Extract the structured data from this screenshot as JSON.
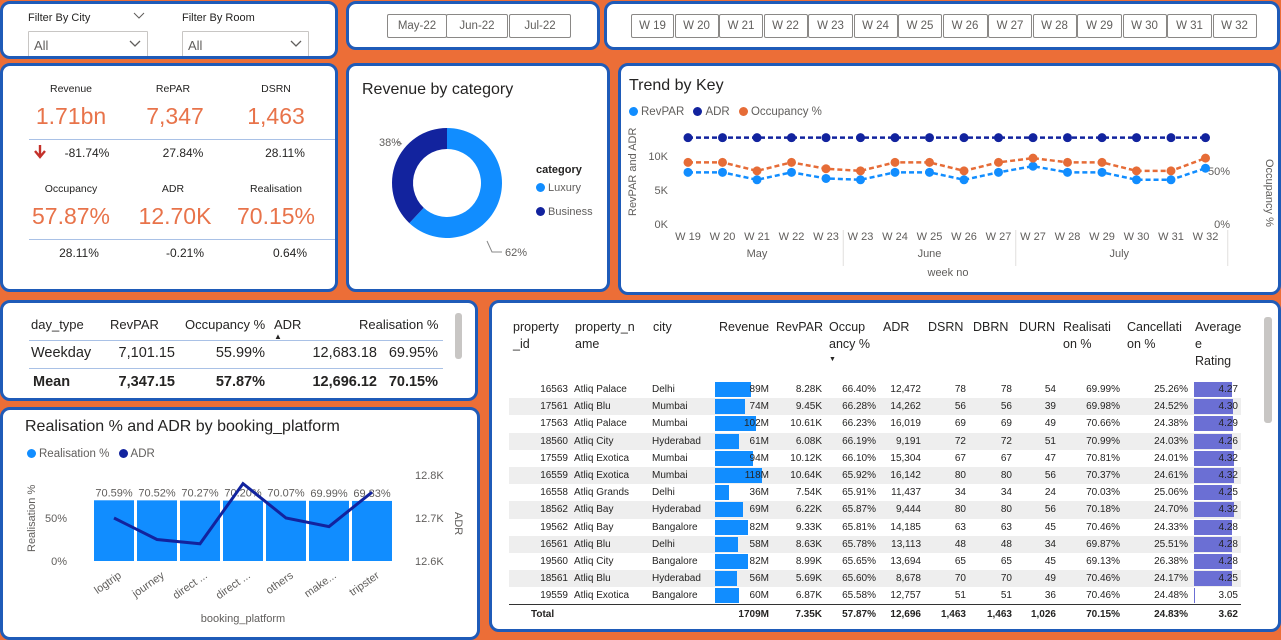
{
  "filters": {
    "city": {
      "label": "Filter By City",
      "value": "All"
    },
    "room": {
      "label": "Filter By Room",
      "value": "All"
    }
  },
  "months": [
    "May-22",
    "Jun-22",
    "Jul-22"
  ],
  "weeks": [
    "W 19",
    "W 20",
    "W 21",
    "W 22",
    "W 23",
    "W 24",
    "W 25",
    "W 26",
    "W 27",
    "W 28",
    "W 29",
    "W 30",
    "W 31",
    "W 32"
  ],
  "kpis": [
    {
      "label": "Revenue",
      "value": "1.71bn",
      "delta": "-81.74%",
      "down": true
    },
    {
      "label": "RePAR",
      "value": "7,347",
      "delta": "27.84%"
    },
    {
      "label": "DSRN",
      "value": "1,463",
      "delta": "28.11%"
    },
    {
      "label": "Occupancy",
      "value": "57.87%",
      "delta": "28.11%"
    },
    {
      "label": "ADR",
      "value": "12.70K",
      "delta": "-0.21%"
    },
    {
      "label": "Realisation",
      "value": "70.15%",
      "delta": "0.64%"
    }
  ],
  "revenue_by_category": {
    "title": "Revenue by category",
    "legend_title": "category",
    "slices": [
      {
        "name": "Luxury",
        "pct": "62%",
        "value": 62,
        "color": "#118dff"
      },
      {
        "name": "Business",
        "pct": "38%",
        "value": 38,
        "color": "#12239e"
      }
    ]
  },
  "trend": {
    "title": "Trend by Key",
    "legend": [
      {
        "name": "RevPAR",
        "color": "#118dff"
      },
      {
        "name": "ADR",
        "color": "#12239e"
      },
      {
        "name": "Occupancy %",
        "color": "#e66c37"
      }
    ],
    "y_left_label": "RevPAR and ADR",
    "y_right_label": "Occupancy %",
    "y_left_ticks": [
      "10K",
      "5K",
      "0K"
    ],
    "y_right_ticks": [
      "50%",
      "0%"
    ],
    "x_labels": [
      "W 19",
      "W 20",
      "W 21",
      "W 22",
      "W 23",
      "W 23",
      "W 24",
      "W 25",
      "W 26",
      "W 27",
      "W 27",
      "W 28",
      "W 29",
      "W 30",
      "W 31",
      "W 32"
    ],
    "groups": [
      "May",
      "June",
      "July"
    ],
    "xlabel": "week no"
  },
  "chart_data": [
    {
      "type": "pie",
      "title": "Revenue by category",
      "categories": [
        "Luxury",
        "Business"
      ],
      "values": [
        62,
        38
      ]
    },
    {
      "type": "line",
      "title": "Trend by Key",
      "xlabel": "week no",
      "ylabel": "RevPAR and ADR",
      "y2label": "Occupancy %",
      "categories": [
        "W 19",
        "W 20",
        "W 21",
        "W 22",
        "W 23",
        "W 23",
        "W 24",
        "W 25",
        "W 26",
        "W 27",
        "W 27",
        "W 28",
        "W 29",
        "W 30",
        "W 31",
        "W 32"
      ],
      "series": [
        {
          "name": "RevPAR",
          "axis": "left",
          "values": [
            7600,
            7600,
            6500,
            7600,
            6700,
            6500,
            7600,
            7600,
            6500,
            7600,
            8500,
            7600,
            7600,
            6500,
            6500,
            8200
          ]
        },
        {
          "name": "ADR",
          "axis": "left",
          "values": [
            12700,
            12700,
            12700,
            12700,
            12700,
            12700,
            12700,
            12700,
            12700,
            12700,
            12700,
            12700,
            12700,
            12700,
            12700,
            12700
          ]
        },
        {
          "name": "Occupancy %",
          "axis": "right",
          "values": [
            58,
            58,
            50,
            58,
            52,
            50,
            58,
            58,
            50,
            58,
            62,
            58,
            58,
            50,
            50,
            62
          ]
        }
      ],
      "ylim": [
        0,
        12500
      ],
      "y2lim": [
        0,
        80
      ]
    },
    {
      "type": "bar",
      "title": "Realisation % and ADR by booking_platform",
      "xlabel": "booking_platform",
      "ylabel": "Realisation %",
      "y2label": "ADR",
      "categories": [
        "logtrip",
        "journey",
        "direct ...",
        "direct ...",
        "others",
        "make...",
        "tripster"
      ],
      "series": [
        {
          "name": "Realisation %",
          "type": "bar",
          "values": [
            70.59,
            70.52,
            70.27,
            70.2,
            70.07,
            69.99,
            69.83
          ],
          "labels": [
            "70.59%",
            "70.52%",
            "70.27%",
            "70.20%",
            "70.07%",
            "69.99%",
            "69.83%"
          ]
        },
        {
          "name": "ADR",
          "type": "line",
          "values": [
            12700,
            12650,
            12640,
            12780,
            12700,
            12680,
            12760
          ]
        }
      ],
      "ylim": [
        0,
        100
      ],
      "y2lim": [
        12600,
        12800
      ]
    }
  ],
  "day_type_table": {
    "headers": [
      "day_type",
      "RevPAR",
      "Occupancy %",
      "ADR",
      "Realisation %"
    ],
    "rows": [
      [
        "Weekday",
        "7,101.15",
        "55.99%",
        "12,683.18",
        "69.95%"
      ]
    ],
    "total": [
      "Mean",
      "7,347.15",
      "57.87%",
      "12,696.12",
      "70.15%"
    ]
  },
  "platform_chart": {
    "title": "Realisation % and ADR by booking_platform",
    "legend": [
      {
        "name": "Realisation %",
        "color": "#118dff"
      },
      {
        "name": "ADR",
        "color": "#12239e"
      }
    ],
    "y_left_ticks": [
      "50%",
      "0%"
    ],
    "y_right_ticks": [
      "12.8K",
      "12.7K",
      "12.6K"
    ],
    "ylabel": "Realisation %",
    "y2label": "ADR",
    "xlabel": "booking_platform"
  },
  "property_table": {
    "headers": [
      "property\n_id",
      "property_n\name",
      "city",
      "Revenue",
      "RevPAR",
      "Occup\nancy %",
      "ADR",
      "DSRN",
      "DBRN",
      "DURN",
      "Realisati\non %",
      "Cancellati\non %",
      "Average\ne\nRating"
    ],
    "rows": [
      [
        "16563",
        "Atliq Palace",
        "Delhi",
        "89M",
        "8.28K",
        "66.40%",
        "12,472",
        "78",
        "78",
        "54",
        "69.99%",
        "25.26%",
        "4.27",
        89,
        4.27
      ],
      [
        "17561",
        "Atliq Blu",
        "Mumbai",
        "74M",
        "9.45K",
        "66.28%",
        "14,262",
        "56",
        "56",
        "39",
        "69.98%",
        "24.52%",
        "4.30",
        74,
        4.3
      ],
      [
        "17563",
        "Atliq Palace",
        "Mumbai",
        "102M",
        "10.61K",
        "66.23%",
        "16,019",
        "69",
        "69",
        "49",
        "70.66%",
        "24.38%",
        "4.29",
        102,
        4.29
      ],
      [
        "18560",
        "Atliq City",
        "Hyderabad",
        "61M",
        "6.08K",
        "66.19%",
        "9,191",
        "72",
        "72",
        "51",
        "70.99%",
        "24.03%",
        "4.26",
        61,
        4.26
      ],
      [
        "17559",
        "Atliq Exotica",
        "Mumbai",
        "94M",
        "10.12K",
        "66.10%",
        "15,304",
        "67",
        "67",
        "47",
        "70.81%",
        "24.01%",
        "4.32",
        94,
        4.32
      ],
      [
        "16559",
        "Atliq Exotica",
        "Mumbai",
        "118M",
        "10.64K",
        "65.92%",
        "16,142",
        "80",
        "80",
        "56",
        "70.37%",
        "24.61%",
        "4.32",
        118,
        4.32
      ],
      [
        "16558",
        "Atliq Grands",
        "Delhi",
        "36M",
        "7.54K",
        "65.91%",
        "11,437",
        "34",
        "34",
        "24",
        "70.03%",
        "25.06%",
        "4.25",
        36,
        4.25
      ],
      [
        "18562",
        "Atliq Bay",
        "Hyderabad",
        "69M",
        "6.22K",
        "65.87%",
        "9,444",
        "80",
        "80",
        "56",
        "70.18%",
        "24.70%",
        "4.32",
        69,
        4.32
      ],
      [
        "19562",
        "Atliq Bay",
        "Bangalore",
        "82M",
        "9.33K",
        "65.81%",
        "14,185",
        "63",
        "63",
        "45",
        "70.46%",
        "24.33%",
        "4.28",
        82,
        4.28
      ],
      [
        "16561",
        "Atliq Blu",
        "Delhi",
        "58M",
        "8.63K",
        "65.78%",
        "13,113",
        "48",
        "48",
        "34",
        "69.87%",
        "25.51%",
        "4.28",
        58,
        4.28
      ],
      [
        "19560",
        "Atliq City",
        "Bangalore",
        "82M",
        "8.99K",
        "65.65%",
        "13,694",
        "65",
        "65",
        "45",
        "69.13%",
        "26.38%",
        "4.28",
        82,
        4.28
      ],
      [
        "18561",
        "Atliq Blu",
        "Hyderabad",
        "56M",
        "5.69K",
        "65.60%",
        "8,678",
        "70",
        "70",
        "49",
        "70.46%",
        "24.17%",
        "4.25",
        56,
        4.25
      ],
      [
        "19559",
        "Atliq Exotica",
        "Bangalore",
        "60M",
        "6.87K",
        "65.58%",
        "12,757",
        "51",
        "51",
        "36",
        "70.46%",
        "24.48%",
        "3.05",
        60,
        3.05
      ]
    ],
    "total": [
      "Total",
      "",
      "",
      "1709M",
      "7.35K",
      "57.87%",
      "12,696",
      "1,463",
      "1,463",
      "1,026",
      "70.15%",
      "24.83%",
      "3.62"
    ]
  }
}
